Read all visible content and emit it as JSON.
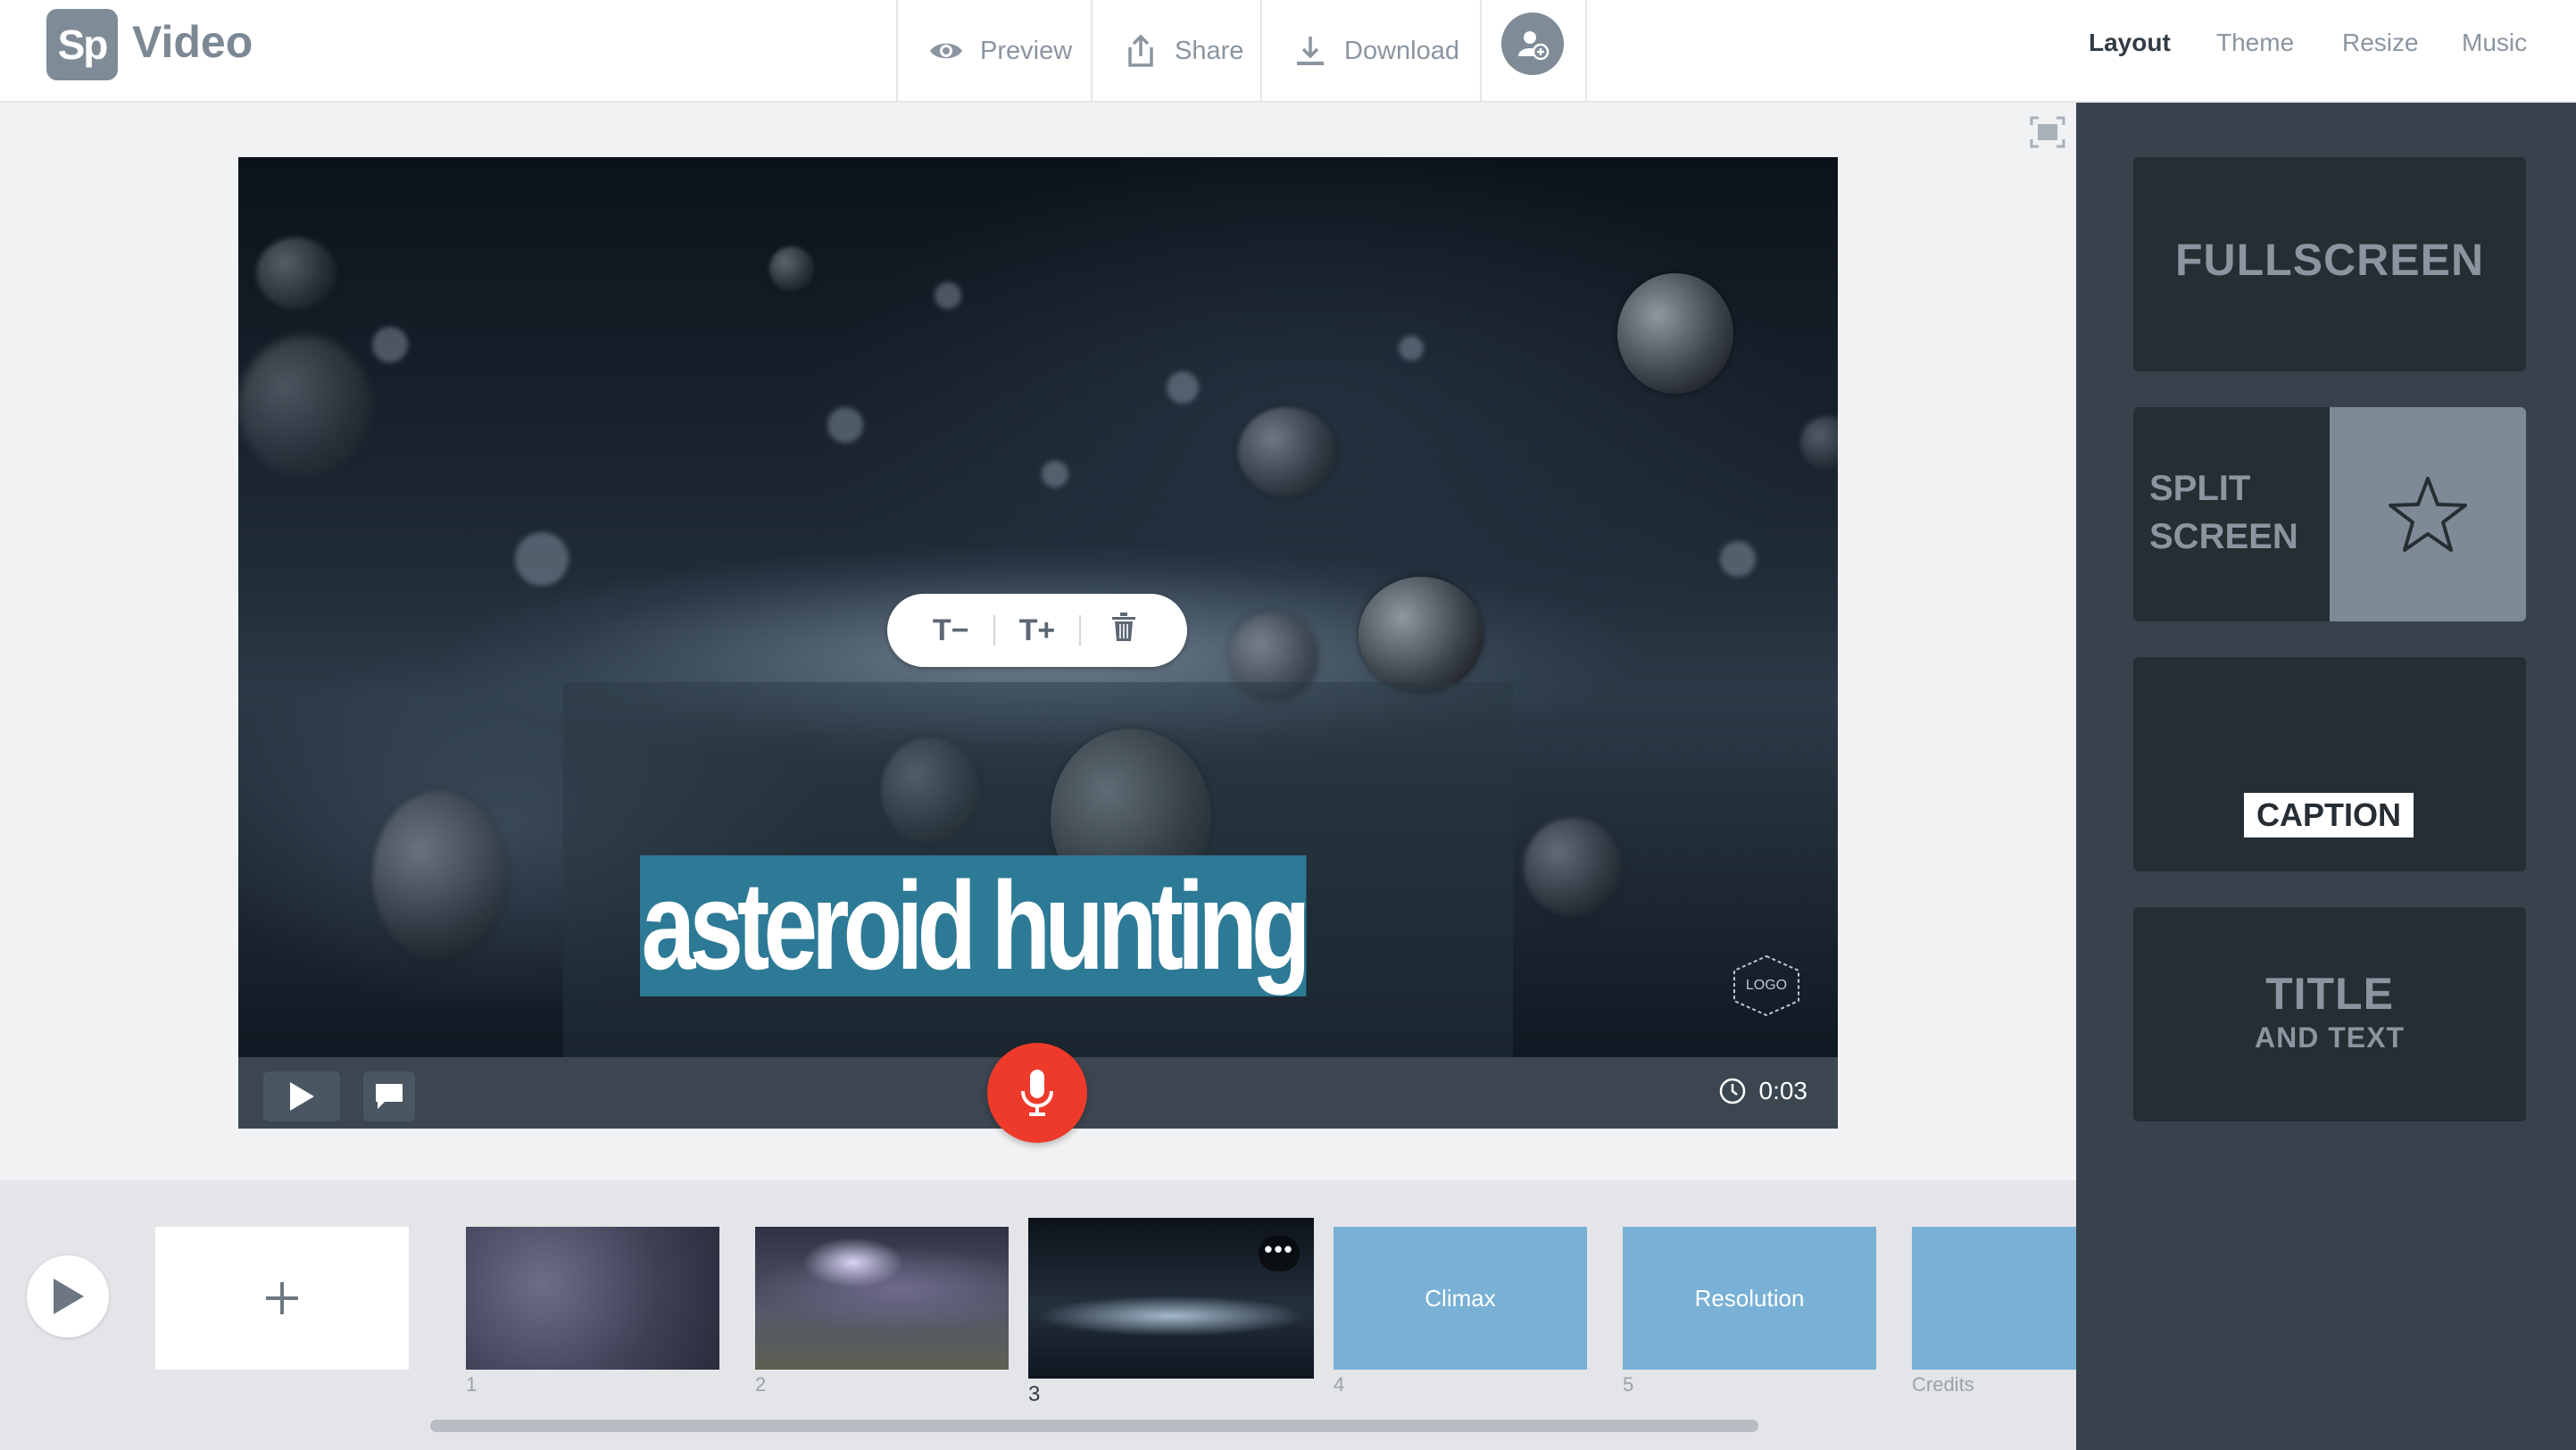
{
  "header": {
    "logo": "Sp",
    "app_name": "Video",
    "preview_label": "Preview",
    "share_label": "Share",
    "download_label": "Download",
    "nav": {
      "layout": "Layout",
      "theme": "Theme",
      "resize": "Resize",
      "music": "Music"
    },
    "active_tab": "Layout"
  },
  "stage": {
    "caption": "asteroid hunting",
    "toolbar": {
      "decrease_text": "T−",
      "increase_text": "T+"
    },
    "logo_badge": "LOGO",
    "time": "0:03"
  },
  "timeline": {
    "slides": [
      {
        "number": "1",
        "kind": "image"
      },
      {
        "number": "2",
        "kind": "image"
      },
      {
        "number": "3",
        "kind": "image",
        "selected": true,
        "menu": "•••"
      },
      {
        "number": "4",
        "kind": "blank",
        "label": "Climax"
      },
      {
        "number": "5",
        "kind": "blank",
        "label": "Resolution"
      },
      {
        "number": "Credits",
        "kind": "blank",
        "label": ""
      }
    ]
  },
  "layouts": {
    "fullscreen": "FULLSCREEN",
    "split_line1": "SPLIT",
    "split_line2": "SCREEN",
    "caption": "CAPTION",
    "title_line1": "TITLE",
    "title_line2": "AND TEXT"
  },
  "colors": {
    "accent_caption": "#2d7a96",
    "record": "#ee3a2a",
    "slide_blank": "#79b0d5",
    "panel": "#38424c"
  },
  "icons": [
    "preview-eye-icon",
    "share-icon",
    "download-icon",
    "add-collaborator-icon",
    "fit-screen-icon",
    "play-icon",
    "comment-icon",
    "clock-icon",
    "microphone-icon",
    "trash-icon",
    "star-icon",
    "plus-icon"
  ]
}
